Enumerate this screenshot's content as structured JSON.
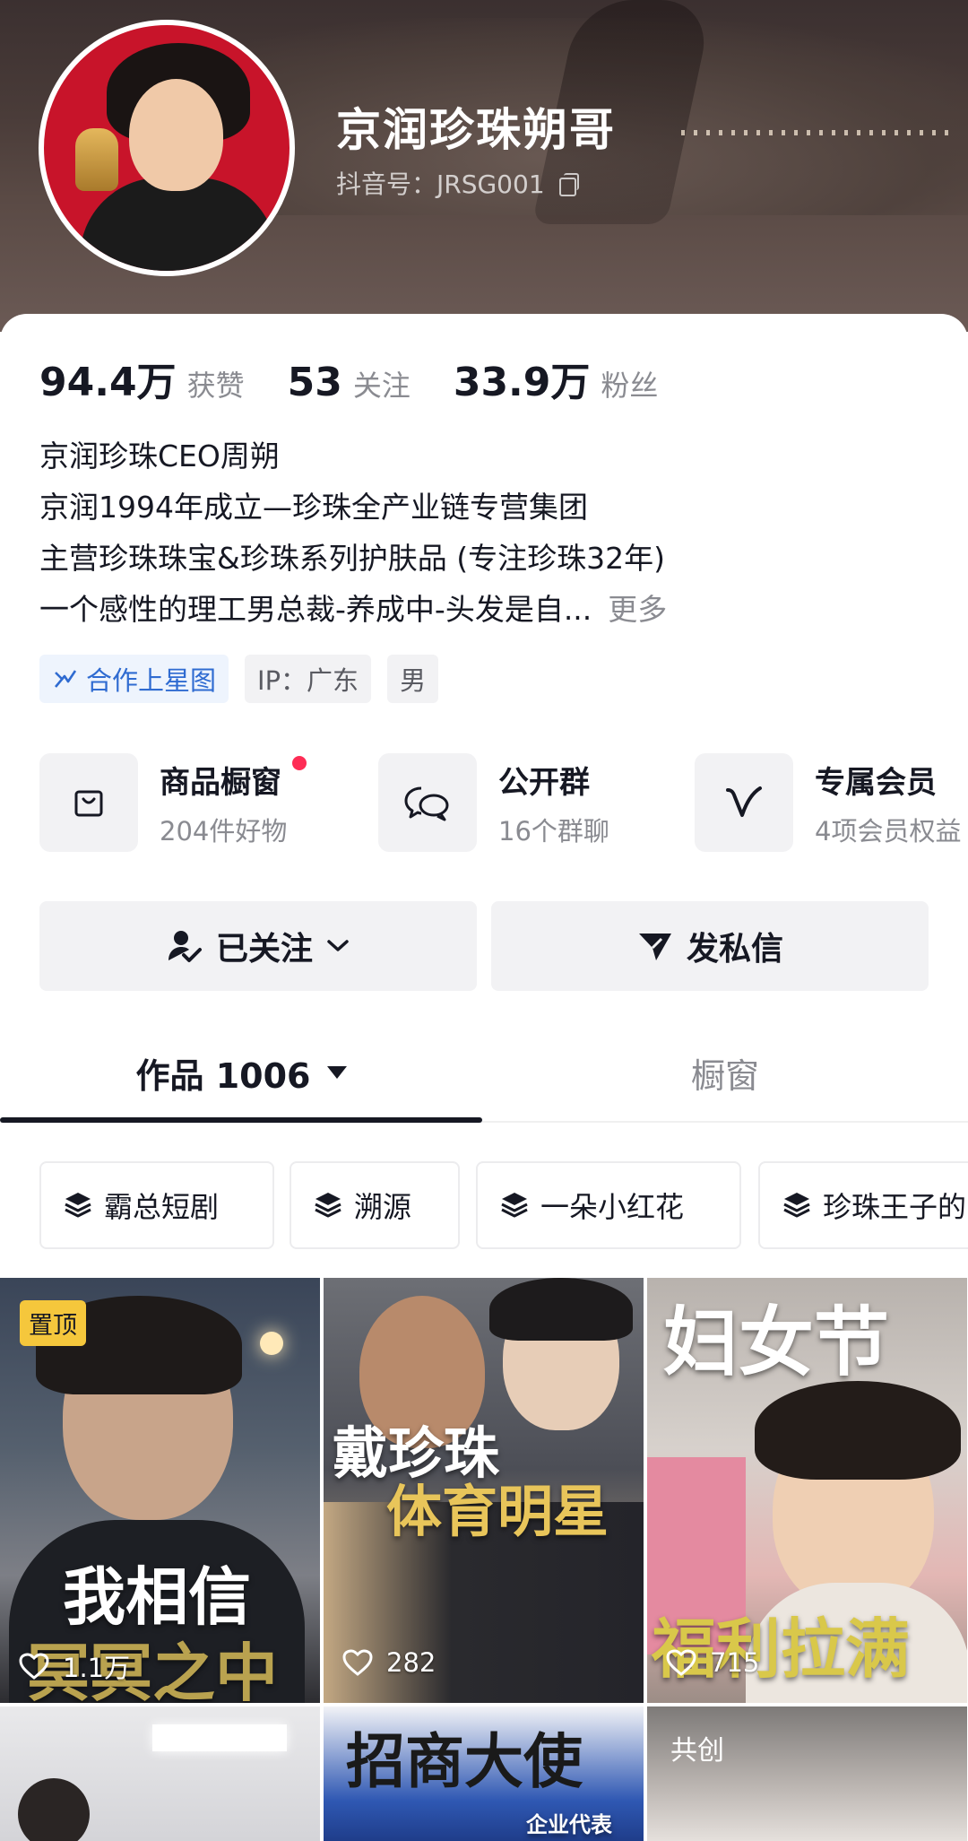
{
  "profile": {
    "name": "京润珍珠朔哥",
    "douyin_id": "抖音号：JRSG001"
  },
  "stats": [
    {
      "value": "94.4万",
      "label": "获赞"
    },
    {
      "value": "53",
      "label": "关注"
    },
    {
      "value": "33.9万",
      "label": "粉丝"
    }
  ],
  "bio": {
    "lines": [
      "京润珍珠CEO周朔",
      "京润1994年成立—珍珠全产业链专营集团",
      "主营珍珠珠宝&珍珠系列护肤品 (专注珍珠32年)",
      "一个感性的理工男总裁-养成中-头发是自..."
    ],
    "more": "更多"
  },
  "tags": [
    {
      "label": "合作上星图",
      "icon": "star-chart-icon"
    },
    {
      "label": "IP：广东"
    },
    {
      "label": "男"
    }
  ],
  "shortcuts": [
    {
      "title": "商品橱窗",
      "sub": "204件好物",
      "icon": "bag-icon"
    },
    {
      "title": "公开群",
      "sub": "16个群聊",
      "icon": "chat-bubbles-icon"
    },
    {
      "title": "专属会员",
      "sub": "4项会员权益",
      "icon": "v-member-icon"
    }
  ],
  "actions": {
    "follow_label": "已关注",
    "message_label": "发私信"
  },
  "tabs": {
    "works_label": "作品 1006",
    "showcase_label": "橱窗"
  },
  "collections": [
    "霸总短剧",
    "溯源",
    "一朵小红花",
    "珍珠王子的"
  ],
  "videos": [
    {
      "badge": "置顶",
      "likes": "1.1万",
      "overlay_top": "我相信",
      "overlay_bottom": "冥冥之中"
    },
    {
      "likes": "282",
      "overlay_top": "戴珍珠",
      "overlay_bottom": "体育明星"
    },
    {
      "likes": "715",
      "overlay_top": "妇女节",
      "overlay_bottom": "福利拉满"
    },
    {},
    {
      "overlay_top": "招商大使",
      "overlay_bottom": "企业代表"
    },
    {
      "badge": "共创"
    }
  ],
  "colors": {
    "accent_red": "#fe2c55",
    "pin_yellow": "#f5c73c",
    "star_blue": "#2f6bd1"
  }
}
